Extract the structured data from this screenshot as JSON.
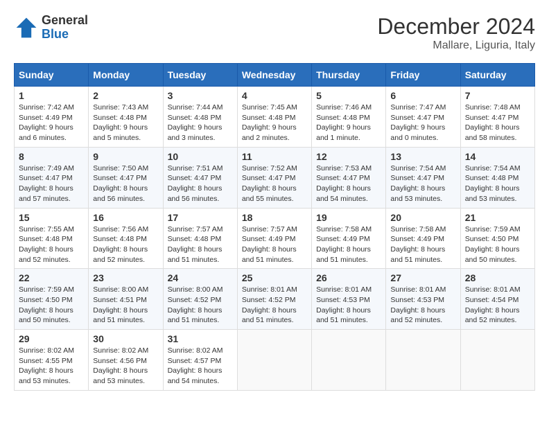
{
  "logo": {
    "general": "General",
    "blue": "Blue"
  },
  "title": "December 2024",
  "location": "Mallare, Liguria, Italy",
  "weekdays": [
    "Sunday",
    "Monday",
    "Tuesday",
    "Wednesday",
    "Thursday",
    "Friday",
    "Saturday"
  ],
  "weeks": [
    [
      {
        "day": "1",
        "info": "Sunrise: 7:42 AM\nSunset: 4:49 PM\nDaylight: 9 hours and 6 minutes."
      },
      {
        "day": "2",
        "info": "Sunrise: 7:43 AM\nSunset: 4:48 PM\nDaylight: 9 hours and 5 minutes."
      },
      {
        "day": "3",
        "info": "Sunrise: 7:44 AM\nSunset: 4:48 PM\nDaylight: 9 hours and 3 minutes."
      },
      {
        "day": "4",
        "info": "Sunrise: 7:45 AM\nSunset: 4:48 PM\nDaylight: 9 hours and 2 minutes."
      },
      {
        "day": "5",
        "info": "Sunrise: 7:46 AM\nSunset: 4:48 PM\nDaylight: 9 hours and 1 minute."
      },
      {
        "day": "6",
        "info": "Sunrise: 7:47 AM\nSunset: 4:47 PM\nDaylight: 9 hours and 0 minutes."
      },
      {
        "day": "7",
        "info": "Sunrise: 7:48 AM\nSunset: 4:47 PM\nDaylight: 8 hours and 58 minutes."
      }
    ],
    [
      {
        "day": "8",
        "info": "Sunrise: 7:49 AM\nSunset: 4:47 PM\nDaylight: 8 hours and 57 minutes."
      },
      {
        "day": "9",
        "info": "Sunrise: 7:50 AM\nSunset: 4:47 PM\nDaylight: 8 hours and 56 minutes."
      },
      {
        "day": "10",
        "info": "Sunrise: 7:51 AM\nSunset: 4:47 PM\nDaylight: 8 hours and 56 minutes."
      },
      {
        "day": "11",
        "info": "Sunrise: 7:52 AM\nSunset: 4:47 PM\nDaylight: 8 hours and 55 minutes."
      },
      {
        "day": "12",
        "info": "Sunrise: 7:53 AM\nSunset: 4:47 PM\nDaylight: 8 hours and 54 minutes."
      },
      {
        "day": "13",
        "info": "Sunrise: 7:54 AM\nSunset: 4:47 PM\nDaylight: 8 hours and 53 minutes."
      },
      {
        "day": "14",
        "info": "Sunrise: 7:54 AM\nSunset: 4:48 PM\nDaylight: 8 hours and 53 minutes."
      }
    ],
    [
      {
        "day": "15",
        "info": "Sunrise: 7:55 AM\nSunset: 4:48 PM\nDaylight: 8 hours and 52 minutes."
      },
      {
        "day": "16",
        "info": "Sunrise: 7:56 AM\nSunset: 4:48 PM\nDaylight: 8 hours and 52 minutes."
      },
      {
        "day": "17",
        "info": "Sunrise: 7:57 AM\nSunset: 4:48 PM\nDaylight: 8 hours and 51 minutes."
      },
      {
        "day": "18",
        "info": "Sunrise: 7:57 AM\nSunset: 4:49 PM\nDaylight: 8 hours and 51 minutes."
      },
      {
        "day": "19",
        "info": "Sunrise: 7:58 AM\nSunset: 4:49 PM\nDaylight: 8 hours and 51 minutes."
      },
      {
        "day": "20",
        "info": "Sunrise: 7:58 AM\nSunset: 4:49 PM\nDaylight: 8 hours and 51 minutes."
      },
      {
        "day": "21",
        "info": "Sunrise: 7:59 AM\nSunset: 4:50 PM\nDaylight: 8 hours and 50 minutes."
      }
    ],
    [
      {
        "day": "22",
        "info": "Sunrise: 7:59 AM\nSunset: 4:50 PM\nDaylight: 8 hours and 50 minutes."
      },
      {
        "day": "23",
        "info": "Sunrise: 8:00 AM\nSunset: 4:51 PM\nDaylight: 8 hours and 51 minutes."
      },
      {
        "day": "24",
        "info": "Sunrise: 8:00 AM\nSunset: 4:52 PM\nDaylight: 8 hours and 51 minutes."
      },
      {
        "day": "25",
        "info": "Sunrise: 8:01 AM\nSunset: 4:52 PM\nDaylight: 8 hours and 51 minutes."
      },
      {
        "day": "26",
        "info": "Sunrise: 8:01 AM\nSunset: 4:53 PM\nDaylight: 8 hours and 51 minutes."
      },
      {
        "day": "27",
        "info": "Sunrise: 8:01 AM\nSunset: 4:53 PM\nDaylight: 8 hours and 52 minutes."
      },
      {
        "day": "28",
        "info": "Sunrise: 8:01 AM\nSunset: 4:54 PM\nDaylight: 8 hours and 52 minutes."
      }
    ],
    [
      {
        "day": "29",
        "info": "Sunrise: 8:02 AM\nSunset: 4:55 PM\nDaylight: 8 hours and 53 minutes."
      },
      {
        "day": "30",
        "info": "Sunrise: 8:02 AM\nSunset: 4:56 PM\nDaylight: 8 hours and 53 minutes."
      },
      {
        "day": "31",
        "info": "Sunrise: 8:02 AM\nSunset: 4:57 PM\nDaylight: 8 hours and 54 minutes."
      },
      {
        "day": "",
        "info": ""
      },
      {
        "day": "",
        "info": ""
      },
      {
        "day": "",
        "info": ""
      },
      {
        "day": "",
        "info": ""
      }
    ]
  ]
}
